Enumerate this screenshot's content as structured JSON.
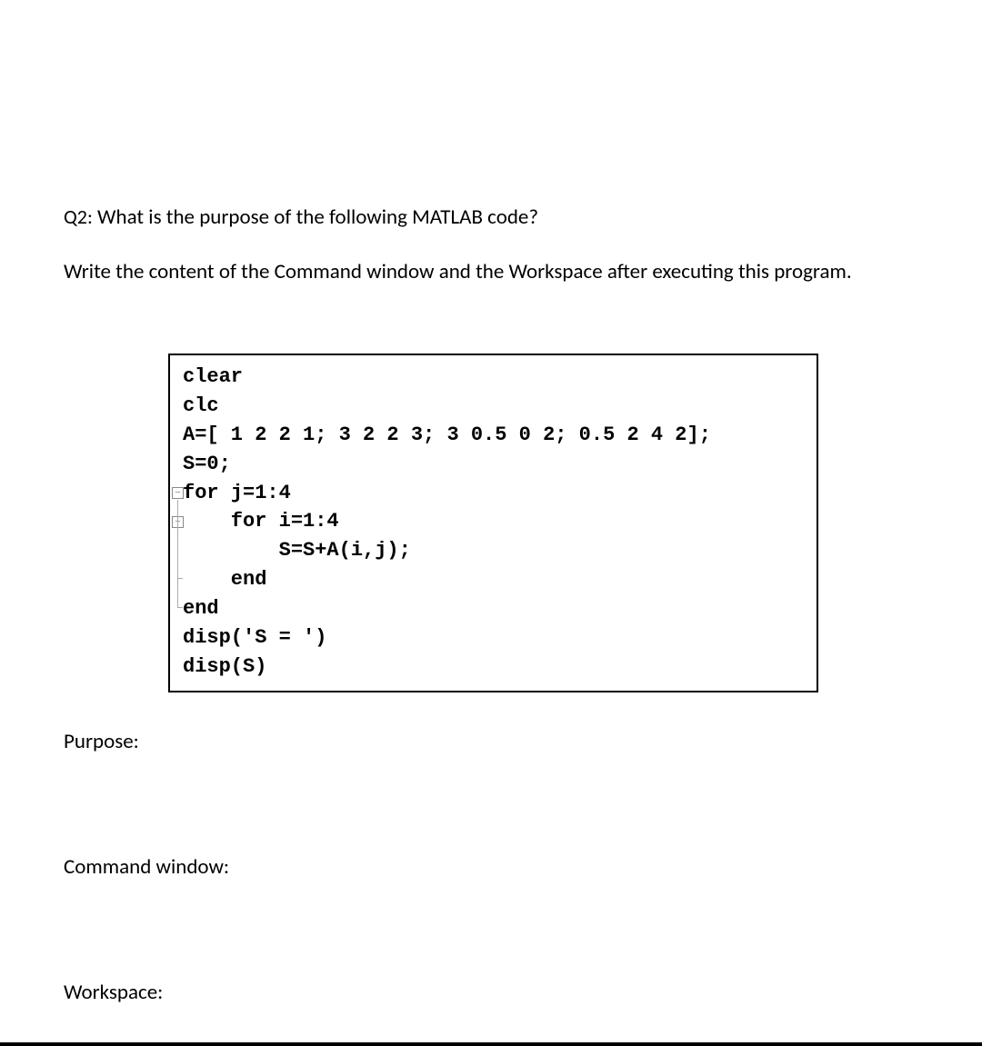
{
  "question": {
    "label": "Q2:",
    "text": "What is the purpose of the following MATLAB code?"
  },
  "instruction": "Write the content of the Command window and the Workspace after executing this program.",
  "code": {
    "lines": [
      "clear",
      "clc",
      "A=[ 1 2 2 1; 3 2 2 3; 3 0.5 0 2; 0.5 2 4 2];",
      "S=0;",
      "for j=1:4",
      "    for i=1:4",
      "        S=S+A(i,j);",
      "    end",
      "end",
      "disp('S = ')",
      "disp(S)"
    ],
    "fold_symbol": "−"
  },
  "sections": {
    "purpose": "Purpose:",
    "command_window": "Command window:",
    "workspace": "Workspace:"
  }
}
